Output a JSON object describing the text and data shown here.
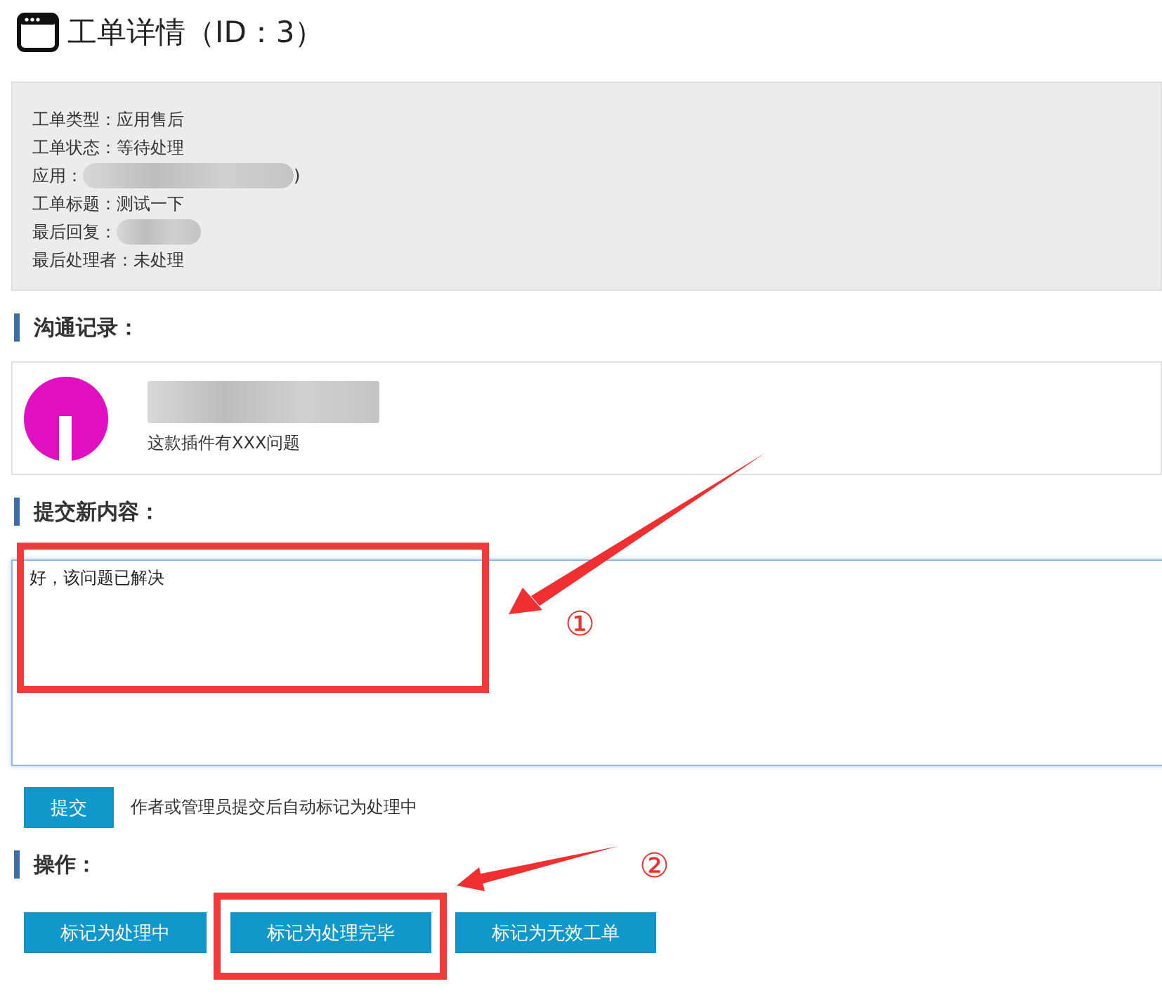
{
  "page_title": "工单详情（ID：3）",
  "info": [
    {
      "label": "工单类型：",
      "value": "应用售后",
      "redacted": false
    },
    {
      "label": "工单状态：",
      "value": "等待处理",
      "redacted": false
    },
    {
      "label": "应用：",
      "value": ")",
      "redacted": true
    },
    {
      "label": "工单标题：",
      "value": "测试一下",
      "redacted": false
    },
    {
      "label": "最后回复：",
      "redacted": true
    },
    {
      "label": "最后处理者：",
      "value": "未处理",
      "redacted": false
    }
  ],
  "communication": {
    "heading": "沟通记录：",
    "messages": [
      {
        "text": "这款插件有XXX问题"
      }
    ]
  },
  "submit": {
    "heading": "提交新内容：",
    "value": "好，该问题已解决",
    "button": "提交",
    "hint": "作者或管理员提交后自动标记为处理中"
  },
  "actions": {
    "heading": "操作：",
    "buttons": [
      "标记为处理中",
      "标记为处理完毕",
      "标记为无效工单"
    ]
  },
  "annotations": [
    {
      "number": "①"
    },
    {
      "number": "②"
    }
  ]
}
